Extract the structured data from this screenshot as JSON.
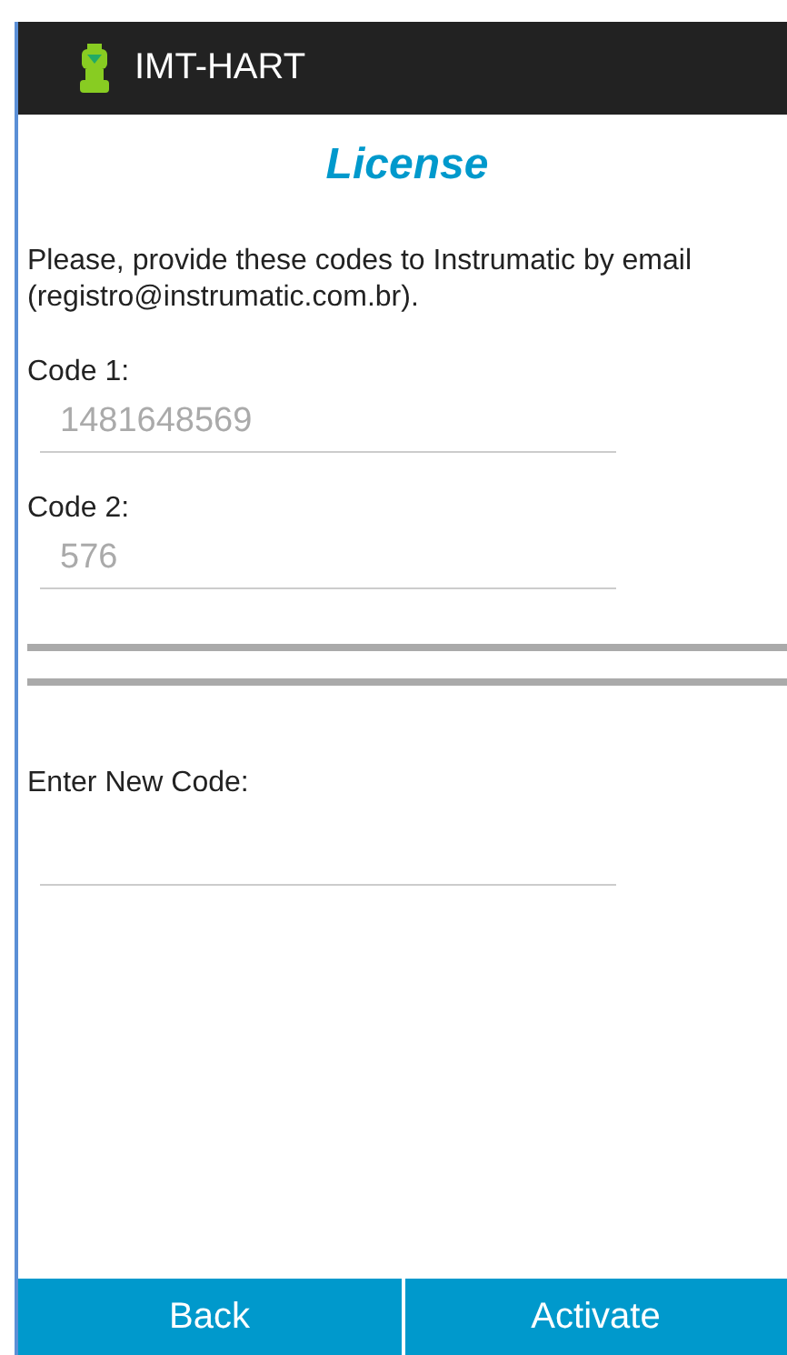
{
  "app_bar": {
    "title": "IMT-HART"
  },
  "heading": "License",
  "instructions": "Please, provide these codes to Instrumatic by email (registro@instrumatic.com.br).",
  "codes": [
    {
      "label": "Code 1:",
      "value": "1481648569",
      "disabled": true
    },
    {
      "label": "Code 2:",
      "value": "576",
      "disabled": true
    }
  ],
  "new_code": {
    "label": "Enter New Code:"
  },
  "buttons": [
    "Back",
    "Activate"
  ]
}
